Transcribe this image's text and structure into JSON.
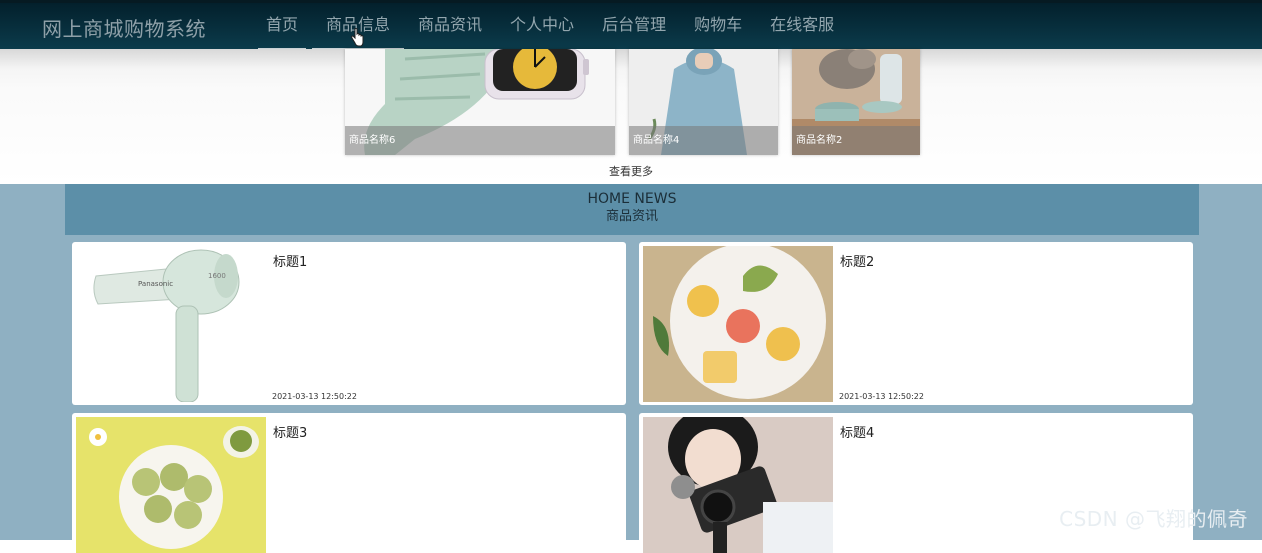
{
  "brand": "网上商城购物系统",
  "nav": [
    "首页",
    "商品信息",
    "商品资讯",
    "个人中心",
    "后台管理",
    "购物车",
    "在线客服"
  ],
  "products": [
    {
      "caption": "商品名称6"
    },
    {
      "caption": "商品名称4"
    },
    {
      "caption": "商品名称2"
    }
  ],
  "more": "查看更多",
  "news_header": {
    "en": "HOME NEWS",
    "cn": "商品资讯"
  },
  "news": [
    {
      "title": "标题1",
      "time": "2021-03-13 12:50:22"
    },
    {
      "title": "标题2",
      "time": "2021-03-13 12:50:22"
    },
    {
      "title": "标题3",
      "time": ""
    },
    {
      "title": "标题4",
      "time": ""
    }
  ],
  "watermark": "CSDN @飞翔的佩奇",
  "colors": {
    "nav_bg": "#0b3b4b",
    "news_header": "#5c8fa8",
    "section_bg": "#8fb0c2"
  }
}
